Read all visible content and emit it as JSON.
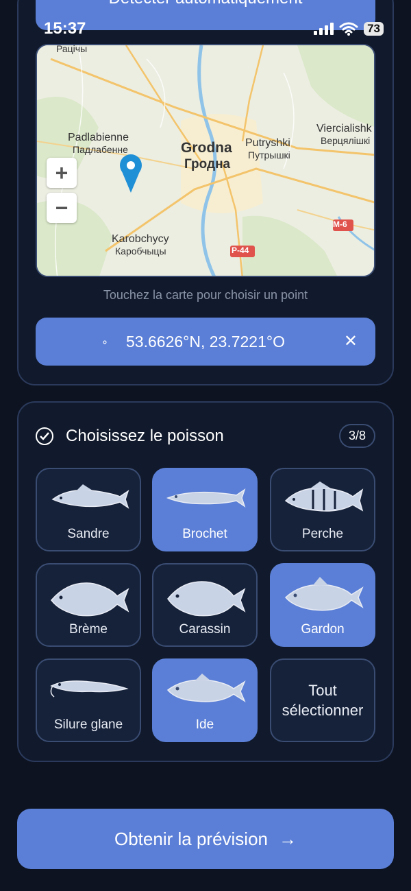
{
  "top_button": {
    "label": "Détecter automatiquement"
  },
  "status": {
    "time": "15:37",
    "battery": "73"
  },
  "map": {
    "labels": [
      {
        "id": "racicy",
        "text": "Рацічы"
      },
      {
        "id": "padlabienne",
        "text": "Padlabienne"
      },
      {
        "id": "padlabienne_cy",
        "text": "Падлабенне"
      },
      {
        "id": "grodna",
        "text": "Grodna"
      },
      {
        "id": "grodna_cy",
        "text": "Гродна"
      },
      {
        "id": "putryshki",
        "text": "Putryshki"
      },
      {
        "id": "putryshki_cy",
        "text": "Путрышкі"
      },
      {
        "id": "viercialishki",
        "text": "Viercialishk"
      },
      {
        "id": "viercialishki_cy",
        "text": "Верцялішкі"
      },
      {
        "id": "karobchycy",
        "text": "Karobchycy"
      },
      {
        "id": "karobchycy_cy",
        "text": "Каробчыцы"
      },
      {
        "id": "m6",
        "text": "M-6"
      },
      {
        "id": "p44",
        "text": "P-44"
      }
    ],
    "zoom_in": "+",
    "zoom_out": "−",
    "hint": "Touchez la carte pour choisir un point"
  },
  "coords": {
    "dot": "∘",
    "value": "53.6626°N, 23.7221°O",
    "clear": "✕"
  },
  "fish_section": {
    "title": "Choisissez le poisson",
    "count": "3/8",
    "select_all": "Tout sélectionner",
    "fish": [
      {
        "label": "Sandre",
        "selected": false
      },
      {
        "label": "Brochet",
        "selected": true
      },
      {
        "label": "Perche",
        "selected": false
      },
      {
        "label": "Brème",
        "selected": false
      },
      {
        "label": "Carassin",
        "selected": false
      },
      {
        "label": "Gardon",
        "selected": true
      },
      {
        "label": "Silure glane",
        "selected": false
      },
      {
        "label": "Ide",
        "selected": true
      }
    ]
  },
  "cta": {
    "label": "Obtenir la prévision",
    "arrow": "→"
  },
  "colors": {
    "accent": "#5b7fd6",
    "background": "#0d1321",
    "card": "#111a2c"
  }
}
